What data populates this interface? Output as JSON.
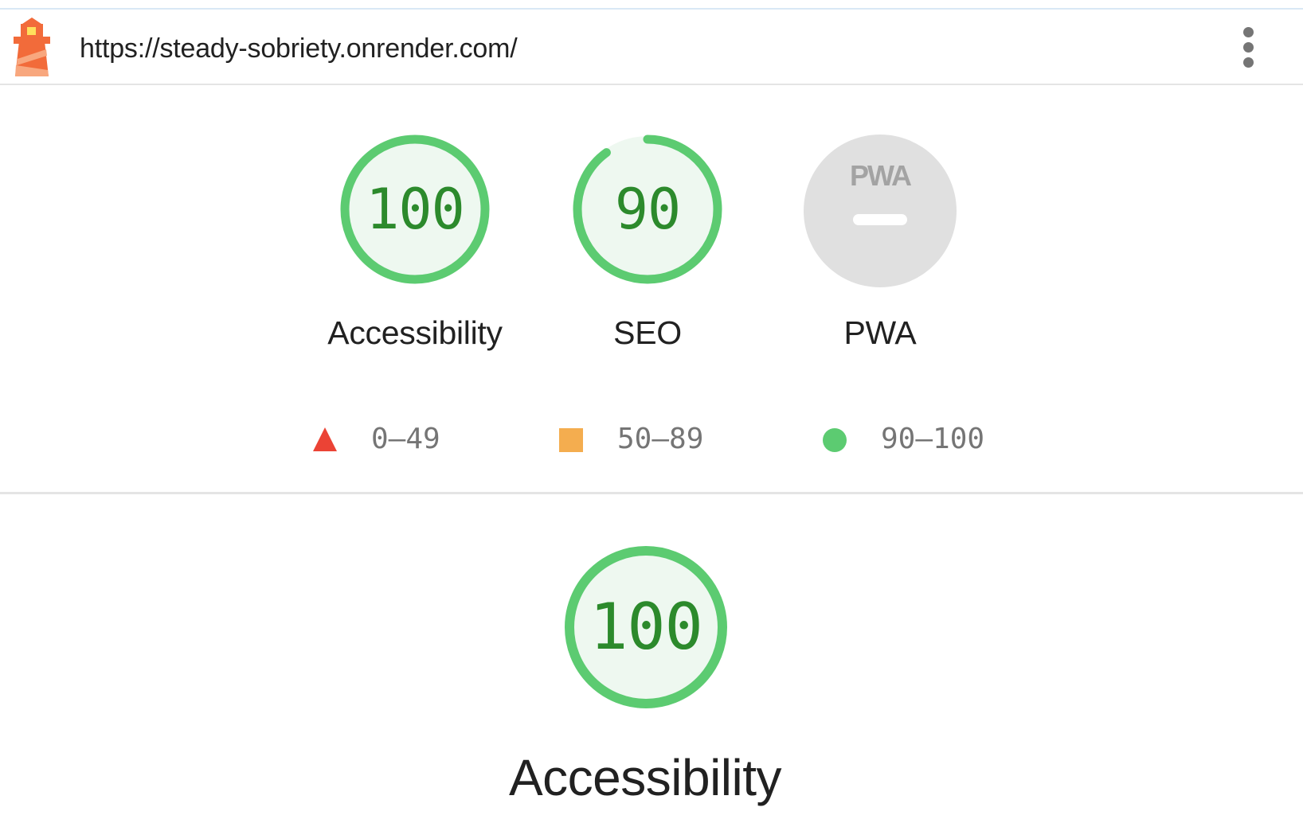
{
  "header": {
    "url": "https://steady-sobriety.onrender.com/",
    "logo_icon": "lighthouse-icon",
    "menu_icon": "more-vertical-icon"
  },
  "gauges": [
    {
      "label": "Accessibility",
      "score": "100",
      "value": 100
    },
    {
      "label": "SEO",
      "score": "90",
      "value": 90
    },
    {
      "label": "PWA",
      "badge": "PWA",
      "value": null
    }
  ],
  "legend": [
    {
      "range": "0–49",
      "icon": "fail-triangle-icon",
      "color": "#eb4335"
    },
    {
      "range": "50–89",
      "icon": "average-square-icon",
      "color": "#f4ad4f"
    },
    {
      "range": "90–100",
      "icon": "pass-circle-icon",
      "color": "#5ccb71"
    }
  ],
  "category": {
    "score": "100",
    "value": 100,
    "title": "Accessibility"
  },
  "colors": {
    "pass": "#0c9b32",
    "pass_ring": "#5ccb71",
    "pass_fill": "#eef8f0",
    "pwa_gray": "#e0e0e0"
  }
}
